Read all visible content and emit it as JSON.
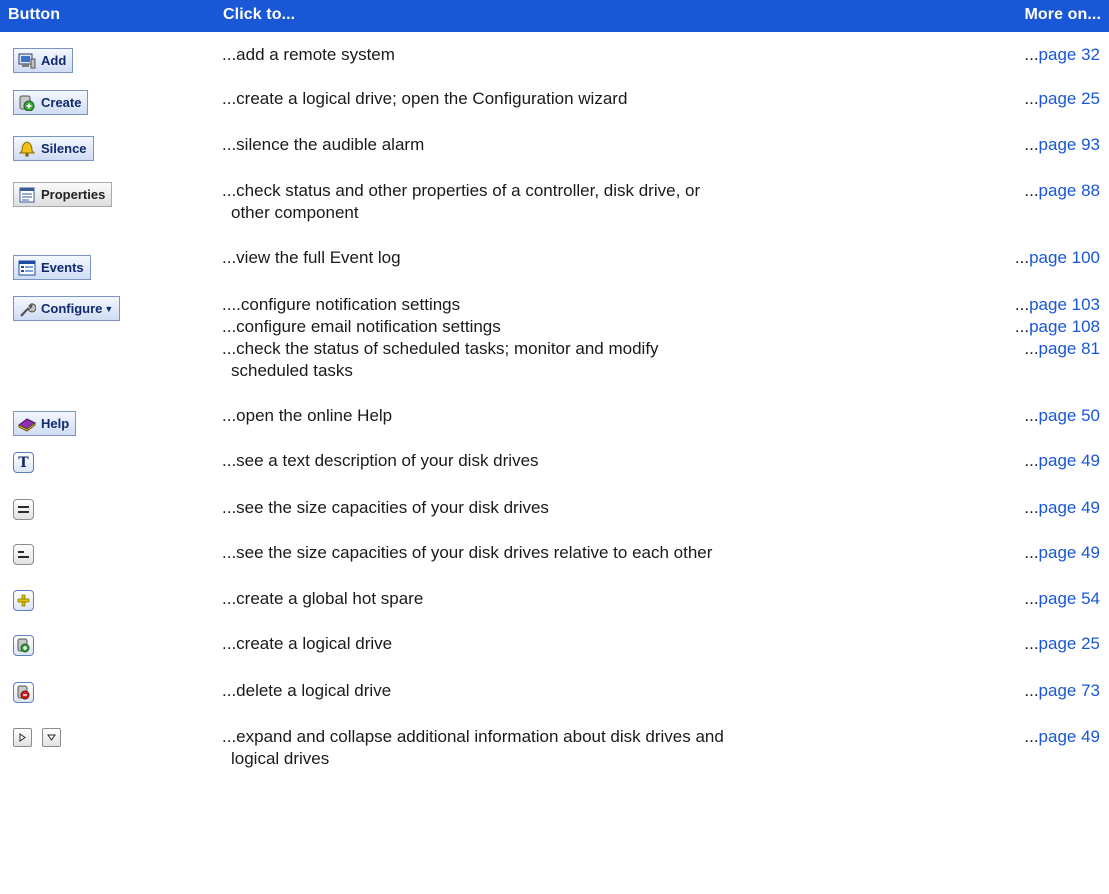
{
  "header": {
    "col_button": "Button",
    "col_click": "Click to...",
    "col_more": "More on..."
  },
  "buttons": {
    "add": "Add",
    "create": "Create",
    "silence": "Silence",
    "properties": "Properties",
    "events": "Events",
    "configure": "Configure",
    "help": "Help",
    "text_view": "T"
  },
  "icons": {
    "add": "monitor-icon",
    "create": "drive-plus-icon",
    "silence": "bell-icon",
    "properties": "clipboard-icon",
    "events": "event-list-icon",
    "configure": "wrench-icon",
    "help": "book-icon",
    "text_view": "text-view-icon",
    "size_view": "size-bars-icon",
    "relative_view": "relative-bars-icon",
    "hot_spare": "plus-icon",
    "create_drive": "drive-plus-icon",
    "delete_drive": "drive-minus-icon",
    "expand": "expand-arrow-icon",
    "collapse": "collapse-arrow-icon"
  },
  "colors": {
    "header_bg": "#1a57d6",
    "link": "#1a57d6"
  },
  "rows": [
    {
      "desc": "...add a remote system",
      "dots": "...",
      "page": "page 32"
    },
    {
      "desc": "...create a logical drive; open the Configuration wizard",
      "dots": "...",
      "page": "page 25"
    },
    {
      "desc": "...silence the audible alarm",
      "dots": "...",
      "page": "page 93"
    },
    {
      "desc_1": "...check status and other properties of a controller, disk drive, or",
      "desc_2": "other component",
      "dots": "...",
      "page": "page 88"
    },
    {
      "desc": "...view the full Event log",
      "dots": "...",
      "page": "page 100"
    },
    {
      "desc": "....configure notification settings",
      "dots": "...",
      "page": "page 103"
    },
    {
      "desc": "...configure email notification settings",
      "dots": "...",
      "page": "page 108"
    },
    {
      "desc_1": "...check the status of scheduled tasks; monitor and modify",
      "desc_2": "scheduled tasks",
      "dots": "...",
      "page": "page 81"
    },
    {
      "desc": "...open the online Help",
      "dots": "...",
      "page": "page 50"
    },
    {
      "desc": "...see a text description of your disk drives",
      "dots": "...",
      "page": "page 49"
    },
    {
      "desc": "...see the size capacities of your disk drives",
      "dots": "...",
      "page": "page 49"
    },
    {
      "desc": "...see the size capacities of your disk drives relative to each other",
      "dots": "...",
      "page": "page 49"
    },
    {
      "desc": "...create a global hot spare",
      "dots": "...",
      "page": "page 54"
    },
    {
      "desc": "...create a logical drive",
      "dots": "...",
      "page": "page 25"
    },
    {
      "desc": "...delete a logical drive",
      "dots": "...",
      "page": "page 73"
    },
    {
      "desc_1": "...expand and collapse additional information about disk drives and",
      "desc_2": "logical drives",
      "dots": "...",
      "page": "page 49"
    }
  ]
}
